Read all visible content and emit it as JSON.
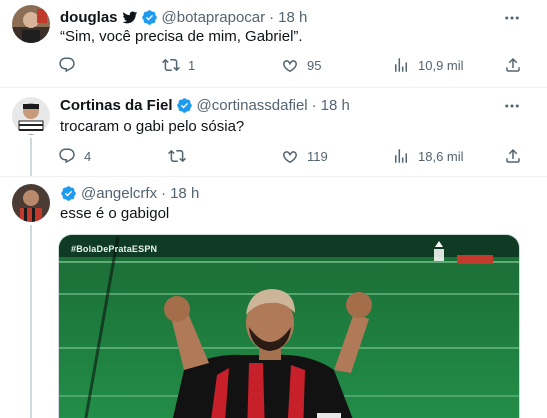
{
  "tweets": [
    {
      "name": "douglas",
      "handle": "@botaprapocar",
      "separator": "·",
      "time": "18 h",
      "text": "“Sim, você precisa de mim, Gabriel”.",
      "reply_count": "",
      "retweet_count": "1",
      "like_count": "95",
      "view_count": "10,9 mil"
    },
    {
      "name": "Cortinas da Fiel",
      "handle": "@cortinassdafiel",
      "separator": "·",
      "time": "18 h",
      "text": "trocaram o gabi pelo sósia?",
      "reply_count": "4",
      "retweet_count": "",
      "like_count": "119",
      "view_count": "18,6 mil"
    },
    {
      "name": "",
      "handle": "@angelcrfx",
      "separator": "·",
      "time": "18 h",
      "text": "esse é o gabigol"
    }
  ],
  "media": {
    "watermark": "#BolaDePrataESPN"
  },
  "colors": {
    "verified": "#1d9bf0",
    "secondary_text": "#536471",
    "divider": "#eff3f4",
    "pitch": "#1e8a3e",
    "jersey_red": "#d2232a"
  }
}
